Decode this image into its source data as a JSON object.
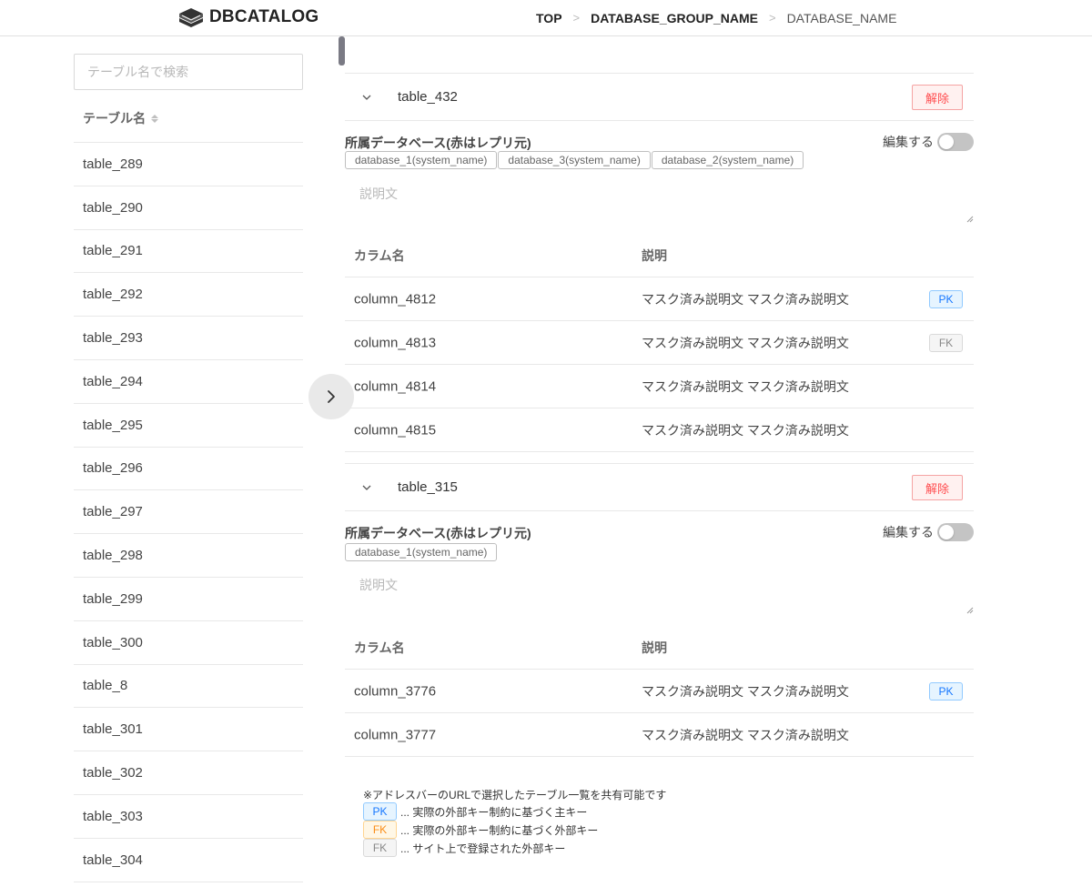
{
  "header": {
    "logo_text": "DBCATALOG",
    "breadcrumb": [
      "TOP",
      "DATABASE_GROUP_NAME",
      "DATABASE_NAME"
    ]
  },
  "sidebar": {
    "search_placeholder": "テーブル名で検索",
    "column_header": "テーブル名",
    "tables": [
      "table_289",
      "table_290",
      "table_291",
      "table_292",
      "table_293",
      "table_294",
      "table_295",
      "table_296",
      "table_297",
      "table_298",
      "table_299",
      "table_300",
      "table_8",
      "table_301",
      "table_302",
      "table_303",
      "table_304"
    ]
  },
  "cards": [
    {
      "name": "table_432",
      "release_label": "解除",
      "db_label": "所属データベース(赤はレプリ元)",
      "edit_label": "編集する",
      "databases": [
        "database_1(system_name)",
        "database_3(system_name)",
        "database_2(system_name)"
      ],
      "description_placeholder": "説明文",
      "col_header_name": "カラム名",
      "col_header_desc": "説明",
      "columns": [
        {
          "name": "column_4812",
          "desc": "マスク済み説明文 マスク済み説明文",
          "badge": "PK"
        },
        {
          "name": "column_4813",
          "desc": "マスク済み説明文 マスク済み説明文",
          "badge": "FK"
        },
        {
          "name": "column_4814",
          "desc": "マスク済み説明文 マスク済み説明文",
          "badge": ""
        },
        {
          "name": "column_4815",
          "desc": "マスク済み説明文 マスク済み説明文",
          "badge": ""
        }
      ]
    },
    {
      "name": "table_315",
      "release_label": "解除",
      "db_label": "所属データベース(赤はレプリ元)",
      "edit_label": "編集する",
      "databases": [
        "database_1(system_name)"
      ],
      "description_placeholder": "説明文",
      "col_header_name": "カラム名",
      "col_header_desc": "説明",
      "columns": [
        {
          "name": "column_3776",
          "desc": "マスク済み説明文 マスク済み説明文",
          "badge": "PK"
        },
        {
          "name": "column_3777",
          "desc": "マスク済み説明文 マスク済み説明文",
          "badge": ""
        }
      ]
    }
  ],
  "legend": {
    "note": "※アドレスバーのURLで選択したテーブル一覧を共有可能です",
    "pk_badge": "PK",
    "pk_text": "... 実際の外部キー制約に基づく主キー",
    "fk_badge": "FK",
    "fk_text": "... 実際の外部キー制約に基づく外部キー",
    "fk2_badge": "FK",
    "fk2_text": "... サイト上で登録された外部キー"
  },
  "colors": {
    "pk": "#1677ff",
    "fk_actual": "#fa8c16",
    "fk_registered": "#888888",
    "release": "#ff4d4f"
  }
}
